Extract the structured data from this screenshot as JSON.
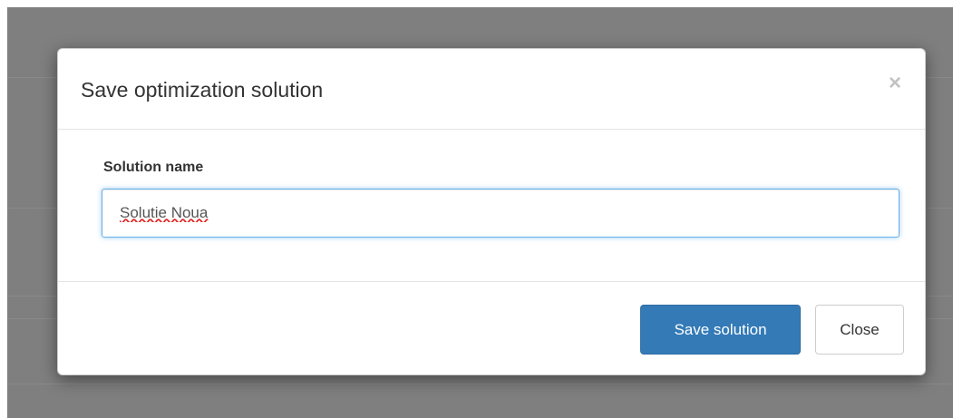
{
  "modal": {
    "title": "Save optimization solution",
    "close_symbol": "×",
    "field_label": "Solution name",
    "input_value": "Solutie Noua",
    "save_label": "Save solution",
    "close_label": "Close"
  },
  "icons": {
    "close": "close-icon"
  },
  "colors": {
    "primary": "#337ab7",
    "backdrop": "#7f7f7f",
    "focus_border": "#66afe9"
  }
}
